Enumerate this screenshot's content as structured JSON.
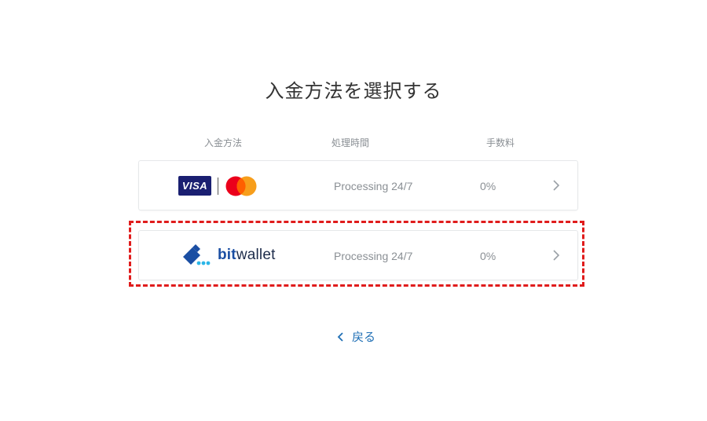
{
  "title": "入金方法を選択する",
  "columns": {
    "method": "入金方法",
    "time": "処理時間",
    "fee": "手数料"
  },
  "methods": [
    {
      "name": "card",
      "logos": [
        "VISA",
        "Mastercard"
      ],
      "visa_label": "VISA",
      "processing": "Processing 24/7",
      "fee": "0%"
    },
    {
      "name": "bitwallet",
      "brand_bit": "bit",
      "brand_wallet": "wallet",
      "processing": "Processing 24/7",
      "fee": "0%",
      "highlighted": true
    }
  ],
  "back": {
    "label": "戻る",
    "icon": "chevron-left-icon"
  },
  "colors": {
    "highlight": "#e01c1c",
    "link": "#1f6fb5",
    "visa": "#1a1f71",
    "mc_red": "#eb001b",
    "mc_orange": "#f79e1b",
    "bitwallet_blue": "#1a4ea3",
    "bitwallet_cyan": "#2bb6e8"
  }
}
